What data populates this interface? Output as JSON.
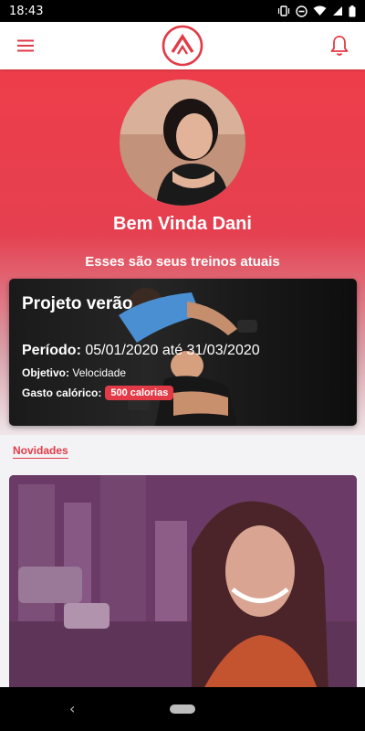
{
  "status_bar": {
    "time": "18:43"
  },
  "app_bar": {
    "menu_icon": "hamburger-menu-icon",
    "logo_icon": "app-logo-icon",
    "bell_icon": "notification-bell-icon"
  },
  "hero": {
    "greeting": "Bem Vinda Dani",
    "subtitle": "Esses são seus treinos atuais"
  },
  "workout": {
    "title": "Projeto verão",
    "period_label": "Período:",
    "period_value": "05/01/2020 até 31/03/2020",
    "objective_label": "Objetivo:",
    "objective_value": "Velocidade",
    "calories_label": "Gasto calórico:",
    "calories_value": "500 calorias"
  },
  "news": {
    "section_title": "Novidades"
  },
  "colors": {
    "accent": "#e23b47",
    "hero_top": "#ee3d4a",
    "background": "#f3f3f5"
  }
}
